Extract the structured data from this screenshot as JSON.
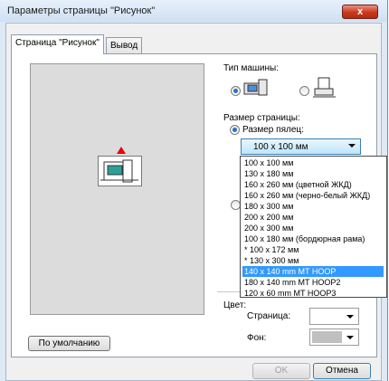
{
  "window": {
    "title": "Параметры страницы \"Рисунок\"",
    "close_glyph": "x"
  },
  "tabs": [
    {
      "label": "Страница \"Рисунок\"",
      "active": true
    },
    {
      "label": "Вывод",
      "active": false
    }
  ],
  "machine": {
    "label": "Тип машины:",
    "selected": "sewing-machine"
  },
  "page_size": {
    "label": "Размер страницы:",
    "hoop_radio_label": "Размер пялец:",
    "combo_value": "100 x 100 мм",
    "options": [
      "100 x 100 мм",
      "130 x 180 мм",
      "160 x 260 мм (цветной ЖКД)",
      "160 x 260 мм (черно-белый ЖКД)",
      "180 x 300 мм",
      "200 x 200 мм",
      "200 x 300 мм",
      "100 x 180 мм (бордюрная рама)",
      "* 100 x 172 мм",
      "* 130 x 300 мм",
      "140 x 140 mm MT HOOP",
      "180 x 140 mm MT HOOP2",
      "120 x 60 mm MT HOOP3"
    ],
    "highlighted_option": "140 x 140 mm MT HOOP"
  },
  "color": {
    "label": "Цвет:",
    "page_label": "Страница:",
    "bg_label": "Фон:",
    "page_color": "#ffffff",
    "bg_color": "#c0c0c0"
  },
  "buttons": {
    "default": "По умолчанию",
    "ok": "OK",
    "cancel": "Отмена"
  }
}
